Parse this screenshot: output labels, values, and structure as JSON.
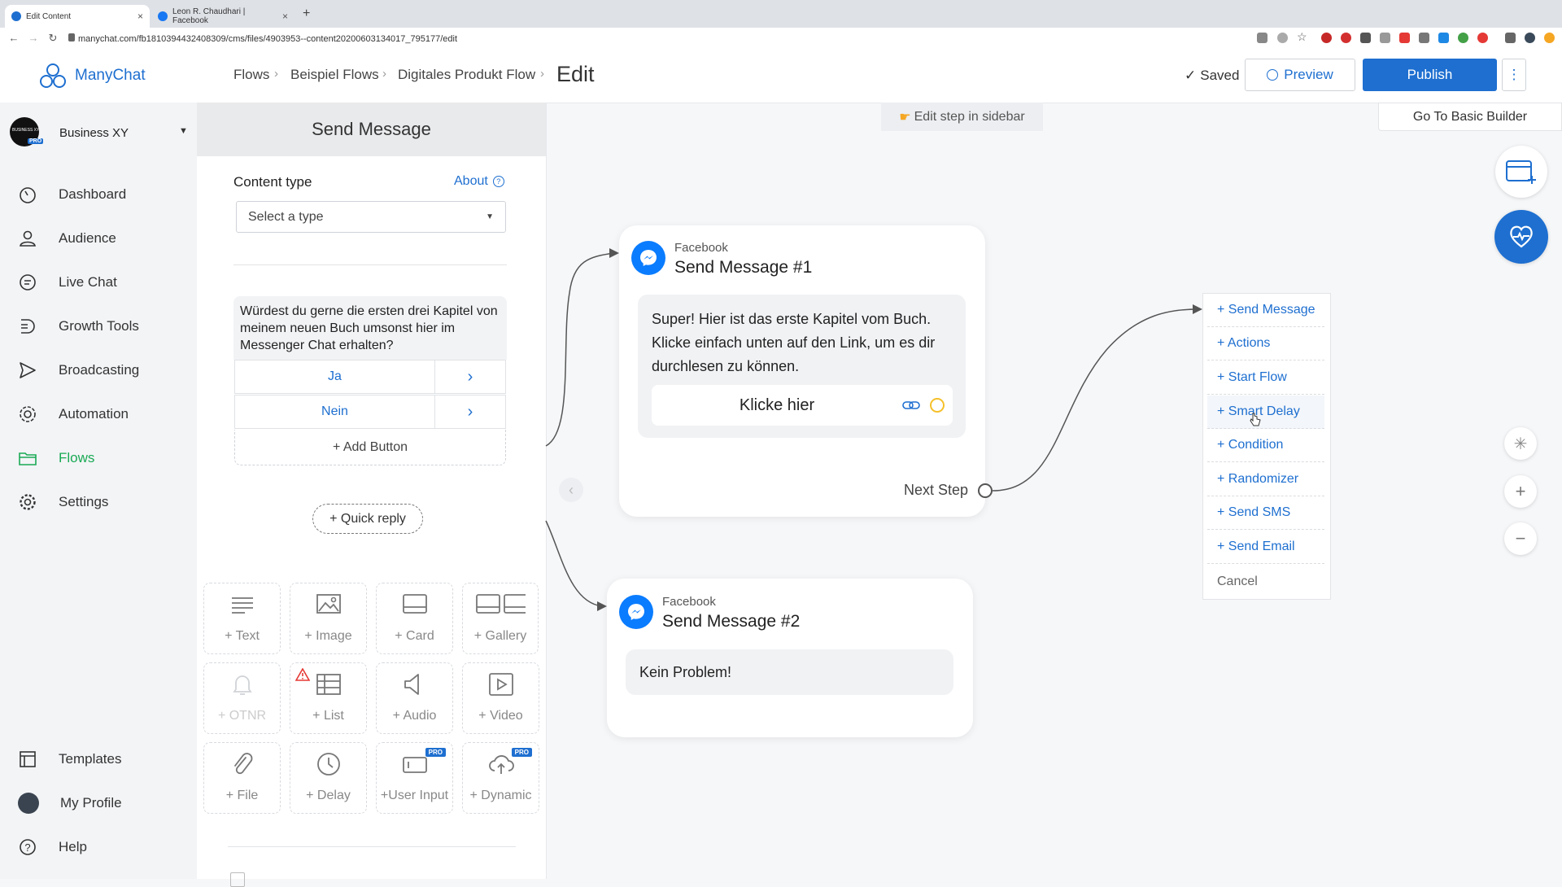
{
  "browser": {
    "tabs": [
      {
        "title": "Edit Content"
      },
      {
        "title": "Leon R. Chaudhari | Facebook"
      }
    ],
    "new_tab": "+",
    "url": "manychat.com/fb181039443240830​9/cms/files/4903953--content20200603134017_795177/edit"
  },
  "app": {
    "logo": "ManyChat",
    "account": {
      "name": "Business XY",
      "avatar_text": "BUSINESS XY",
      "badge": "PRO"
    }
  },
  "breadcrumb": [
    "Flows",
    "Beispiel Flows",
    "Digitales Produkt Flow"
  ],
  "page_title": "Edit",
  "header": {
    "saved": "Saved",
    "preview": "Preview",
    "publish": "Publish",
    "more": "⋮"
  },
  "sidebar": {
    "items": [
      {
        "label": "Dashboard",
        "icon": "dashboard-icon"
      },
      {
        "label": "Audience",
        "icon": "user-icon"
      },
      {
        "label": "Live Chat",
        "icon": "chat-icon"
      },
      {
        "label": "Growth Tools",
        "icon": "growth-tools-icon"
      },
      {
        "label": "Broadcasting",
        "icon": "send-icon"
      },
      {
        "label": "Automation",
        "icon": "automation-icon"
      },
      {
        "label": "Flows",
        "icon": "folder-icon",
        "active": true
      },
      {
        "label": "Settings",
        "icon": "gear-icon"
      }
    ],
    "bottom": [
      {
        "label": "Templates",
        "icon": "templates-icon"
      },
      {
        "label": "My Profile",
        "icon": "profile-avatar"
      },
      {
        "label": "Help",
        "icon": "help-icon"
      }
    ]
  },
  "editor": {
    "title": "Send Message",
    "content_type_label": "Content type",
    "about": "About",
    "select_placeholder": "Select a type",
    "message_text": "Würdest du gerne die ersten drei Kapitel von meinem neuen Buch umsonst hier im Messenger Chat erhalten?",
    "buttons": [
      "Ja",
      "Nein"
    ],
    "add_button": "+ Add Button",
    "quick_reply": "+ Quick reply",
    "tiles": [
      {
        "label": "+ Text",
        "icon": "text-icon"
      },
      {
        "label": "+ Image",
        "icon": "image-icon"
      },
      {
        "label": "+ Card",
        "icon": "card-icon"
      },
      {
        "label": "+ Gallery",
        "icon": "gallery-icon"
      },
      {
        "label": "+ OTNR",
        "icon": "bell-icon",
        "disabled": true
      },
      {
        "label": "+ List",
        "icon": "list-icon",
        "warning": true
      },
      {
        "label": "+ Audio",
        "icon": "audio-icon"
      },
      {
        "label": "+ Video",
        "icon": "video-icon"
      },
      {
        "label": "+ File",
        "icon": "paperclip-icon"
      },
      {
        "label": "+ Delay",
        "icon": "clock-icon"
      },
      {
        "label": "+User Input",
        "icon": "user-input-icon",
        "pro": "PRO"
      },
      {
        "label": "+ Dynamic",
        "icon": "cloud-icon",
        "pro": "PRO"
      }
    ]
  },
  "canvas": {
    "hint": "Edit step in sidebar",
    "basic_builder": "Go To Basic Builder",
    "node1": {
      "source": "Facebook",
      "title": "Send Message #1",
      "text": "Super! Hier ist das erste Kapitel vom Buch. Klicke einfach unten auf den Link, um es dir durchlesen zu können.",
      "button": "Klicke hier",
      "next_step": "Next Step"
    },
    "node2": {
      "source": "Facebook",
      "title": "Send Message #2",
      "text": "Kein Problem!"
    },
    "menu": [
      "+ Send Message",
      "+ Actions",
      "+ Start Flow",
      "+ Smart Delay",
      "+ Condition",
      "+ Randomizer",
      "+ Send SMS",
      "+ Send Email",
      "Cancel"
    ],
    "zoom_in": "+",
    "zoom_out": "−"
  },
  "colors": {
    "brand_blue": "#1e6fd0",
    "active_green": "#1aaa55",
    "messenger_blue": "#0a7cff"
  }
}
